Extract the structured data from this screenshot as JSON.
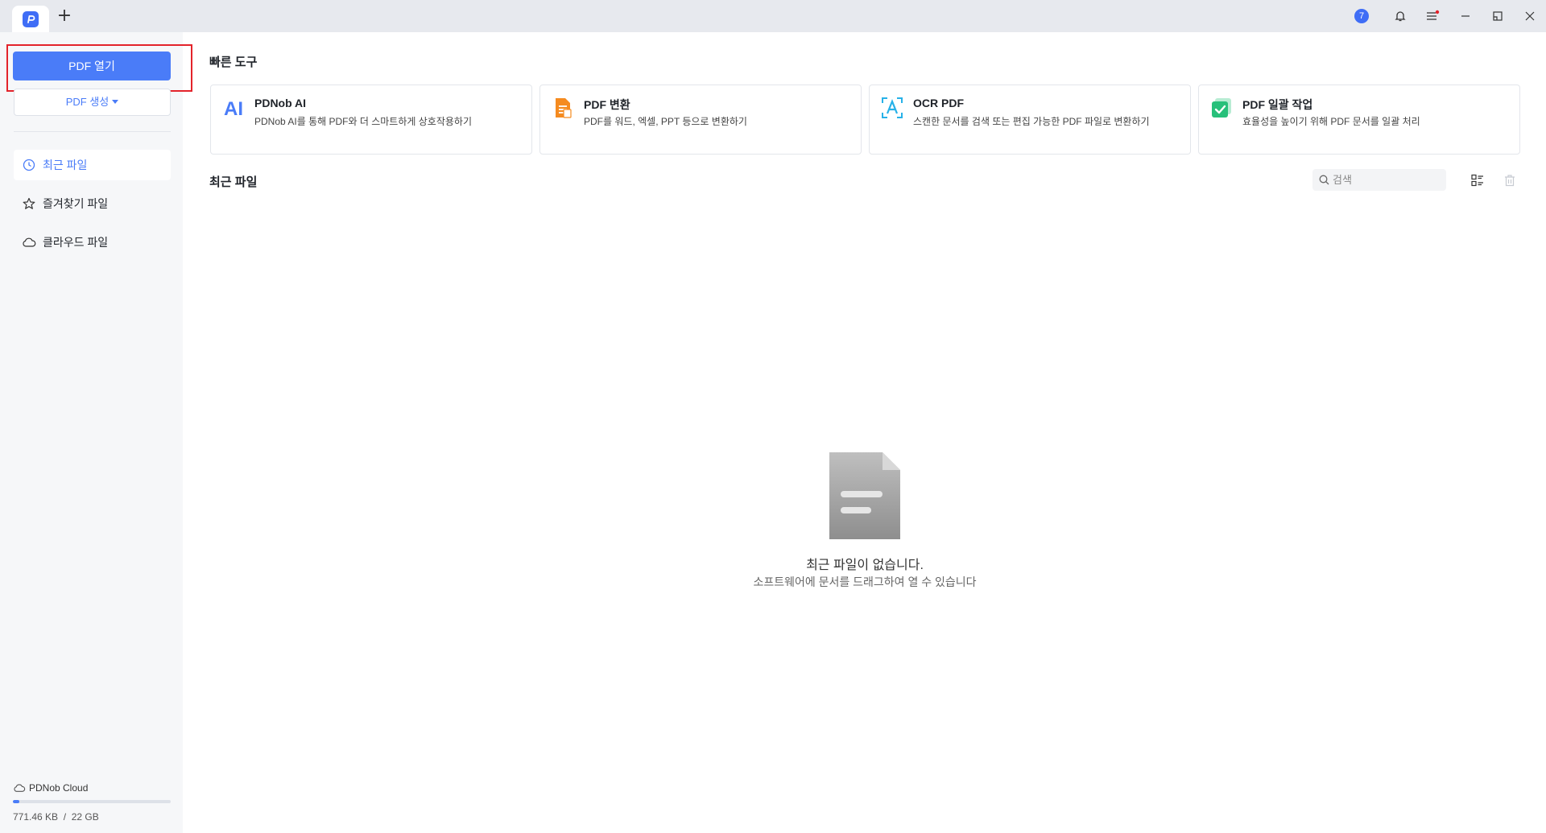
{
  "titlebar": {
    "badge_count": "7",
    "icons": [
      "app-logo-icon",
      "plus-icon",
      "notification-bell-icon",
      "menu-icon",
      "minimize-icon",
      "restore-icon",
      "close-icon"
    ]
  },
  "sidebar": {
    "open_pdf_label": "PDF 열기",
    "create_pdf_label": "PDF 생성",
    "nav": [
      {
        "label": "최근 파일",
        "icon": "clock-icon",
        "active": true
      },
      {
        "label": "즐겨찾기 파일",
        "icon": "star-icon",
        "active": false
      },
      {
        "label": "클라우드 파일",
        "icon": "cloud-icon",
        "active": false
      }
    ],
    "cloud": {
      "title": "PDNob Cloud",
      "usage": "771.46 KB  /  22 GB",
      "usage_fraction": 0.04
    }
  },
  "quick_tools": {
    "title": "빠른 도구",
    "cards": [
      {
        "name": "PDNob AI",
        "desc": "PDNob AI를 통해 PDF와 더 스마트하게 상호작용하기",
        "icon": "ai-icon"
      },
      {
        "name": "PDF 변환",
        "desc": "PDF를 워드, 엑셀, PPT 등으로 변환하기",
        "icon": "convert-icon"
      },
      {
        "name": "OCR PDF",
        "desc": "스캔한 문서를 검색 또는 편집 가능한 PDF 파일로 변환하기",
        "icon": "ocr-icon"
      },
      {
        "name": "PDF 일괄 작업",
        "desc": "효율성을 높이기 위해 PDF 문서를 일괄 처리",
        "icon": "batch-icon"
      }
    ]
  },
  "recent": {
    "title": "최근 파일",
    "search_placeholder": "검색",
    "empty_title": "최근 파일이 없습니다.",
    "empty_subtitle": "소프트웨어에 문서를 드래그하여 열 수 있습니다"
  },
  "colors": {
    "accent": "#4a7cf8",
    "highlight_border": "#e3232b"
  }
}
